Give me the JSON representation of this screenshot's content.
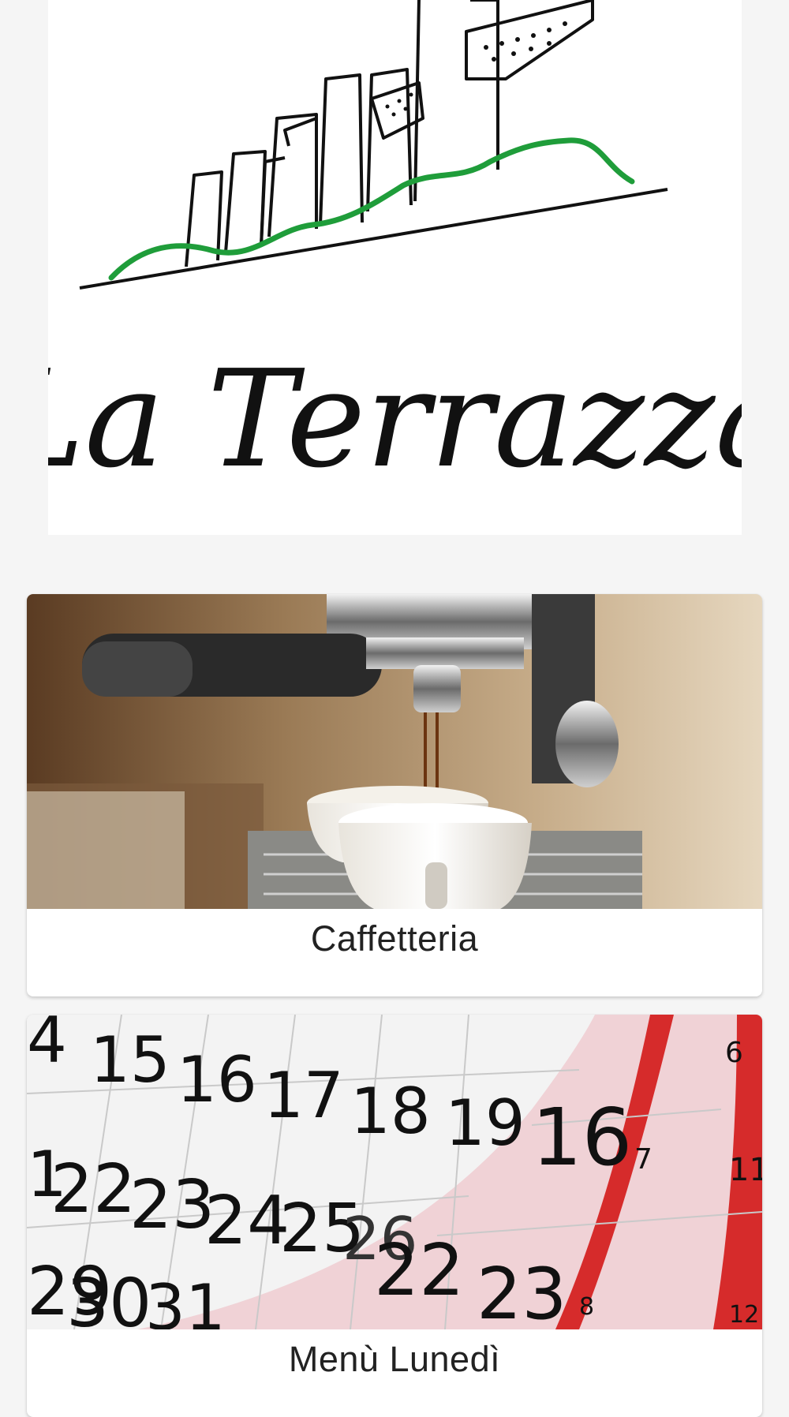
{
  "logo": {
    "text": "La Terrazza",
    "icon": "city-skyline-logo",
    "line_color": "#111111",
    "accent_color": "#1f9d3a"
  },
  "cards": [
    {
      "title": "Caffetteria",
      "image": "espresso-machine-photo"
    },
    {
      "title": "Menù Lunedì",
      "image": "calendar-photo"
    }
  ],
  "colors": {
    "background": "#f5f5f5",
    "card_background": "#ffffff",
    "text": "#222222",
    "calendar_red": "#d62b2b"
  }
}
